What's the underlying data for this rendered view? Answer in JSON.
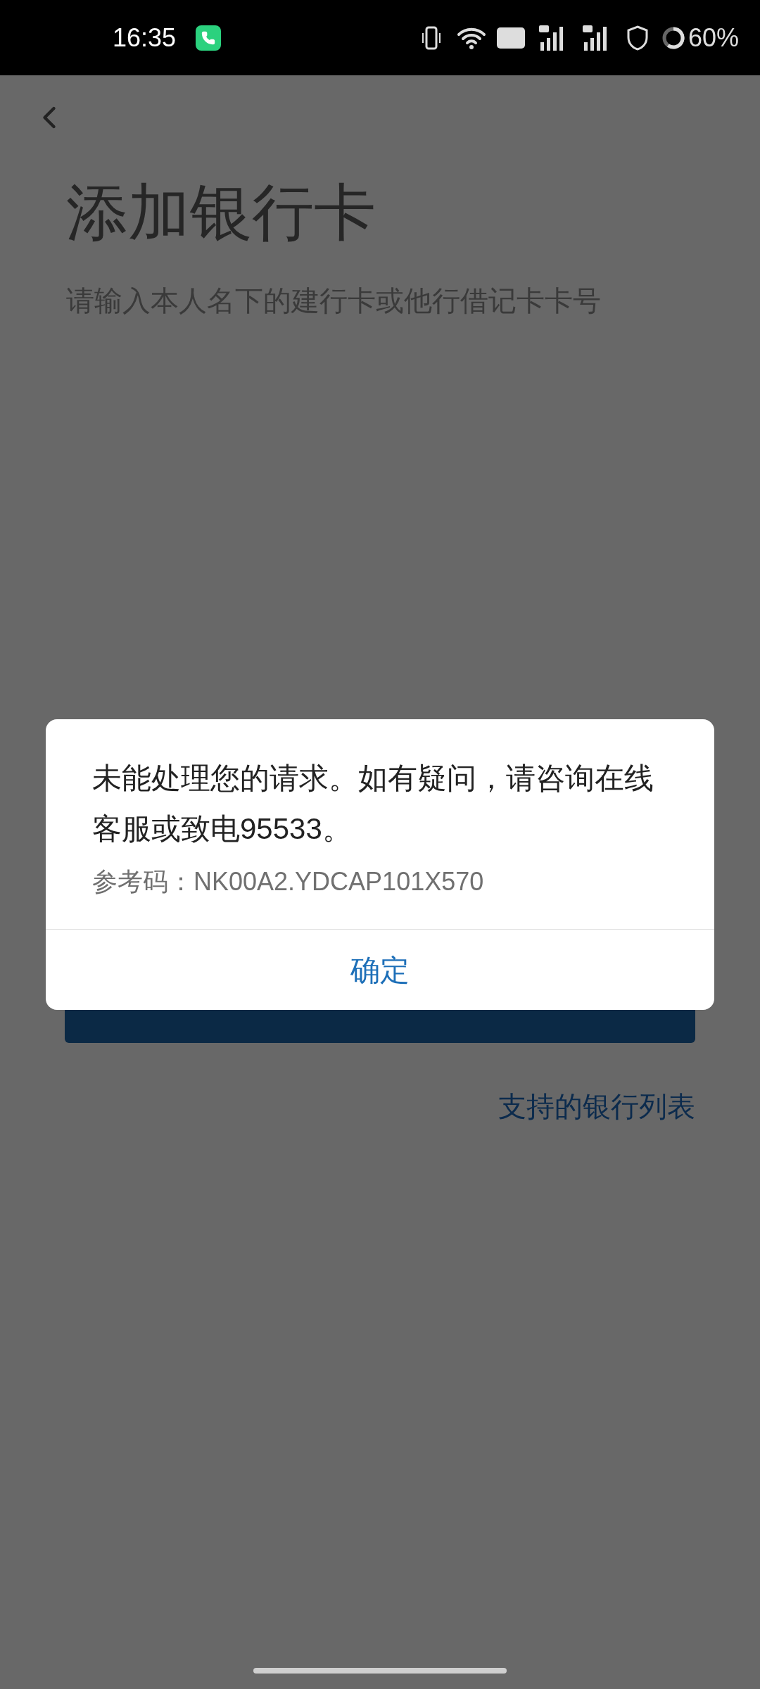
{
  "status_bar": {
    "time": "16:35",
    "battery": "60%"
  },
  "page": {
    "title": "添加银行卡",
    "subtitle": "请输入本人名下的建行卡或他行借记卡卡号",
    "link": "支持的银行列表"
  },
  "dialog": {
    "message": "未能处理您的请求。如有疑问，请咨询在线客服或致电95533。",
    "reference": "参考码：NK00A2.YDCAP101X570",
    "buttons": [
      "确定"
    ]
  }
}
